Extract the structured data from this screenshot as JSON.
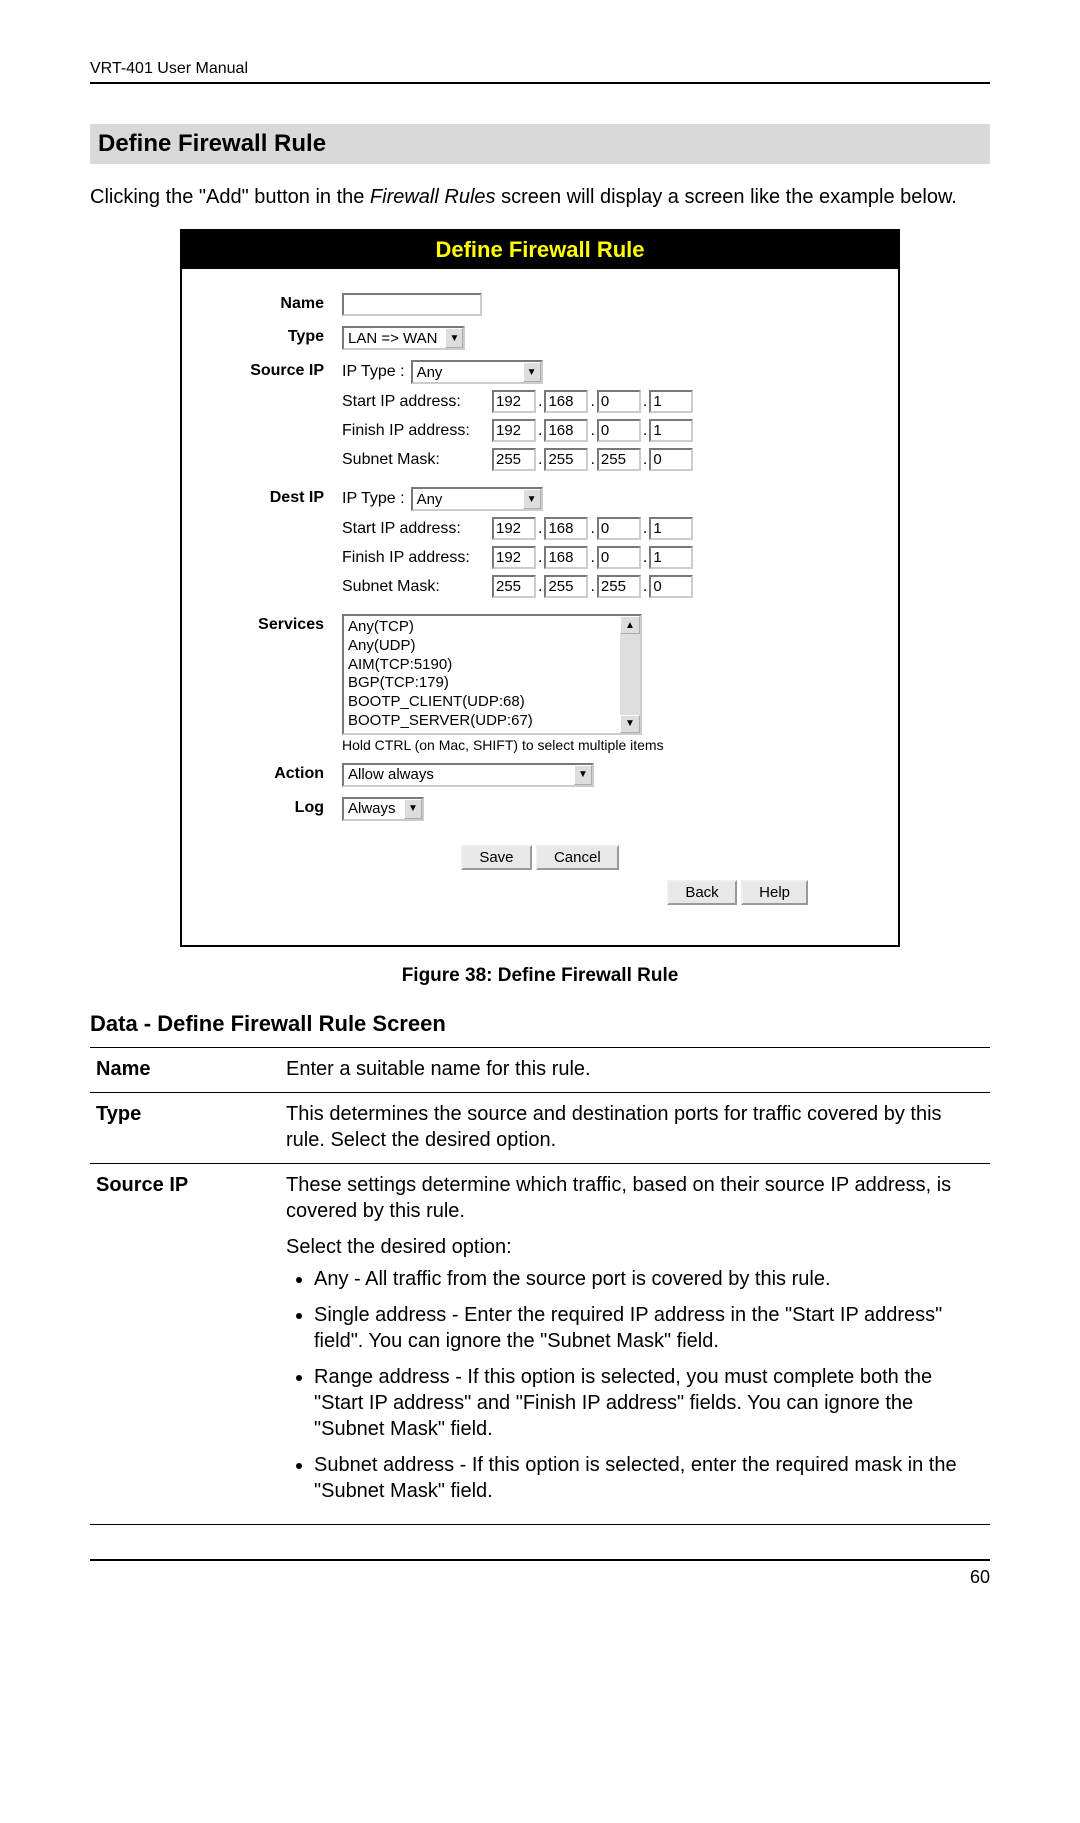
{
  "header": {
    "title": "VRT-401 User Manual"
  },
  "section": {
    "heading": "Define Firewall Rule",
    "intro_prefix": "Clicking the \"Add\" button in the ",
    "intro_italic": "Firewall Rules",
    "intro_suffix": " screen will display a screen like the example below."
  },
  "screenshot": {
    "title": "Define Firewall Rule",
    "labels": {
      "name": "Name",
      "type": "Type",
      "source_ip": "Source IP",
      "dest_ip": "Dest IP",
      "services": "Services",
      "action": "Action",
      "log": "Log",
      "ip_type": "IP Type :",
      "start_ip": "Start IP address:",
      "finish_ip": "Finish IP address:",
      "subnet": "Subnet Mask:"
    },
    "name_value": "",
    "type_value": "LAN => WAN",
    "source": {
      "ip_type": "Any",
      "start": [
        "192",
        "168",
        "0",
        "1"
      ],
      "finish": [
        "192",
        "168",
        "0",
        "1"
      ],
      "mask": [
        "255",
        "255",
        "255",
        "0"
      ]
    },
    "dest": {
      "ip_type": "Any",
      "start": [
        "192",
        "168",
        "0",
        "1"
      ],
      "finish": [
        "192",
        "168",
        "0",
        "1"
      ],
      "mask": [
        "255",
        "255",
        "255",
        "0"
      ]
    },
    "services": [
      "Any(TCP)",
      "Any(UDP)",
      "AIM(TCP:5190)",
      "BGP(TCP:179)",
      "BOOTP_CLIENT(UDP:68)",
      "BOOTP_SERVER(UDP:67)"
    ],
    "services_hint": "Hold CTRL (on Mac, SHIFT) to select multiple items",
    "action_value": "Allow always",
    "log_value": "Always",
    "buttons": {
      "save": "Save",
      "cancel": "Cancel",
      "back": "Back",
      "help": "Help"
    }
  },
  "figure_caption": "Figure 38: Define Firewall Rule",
  "data_section": {
    "heading": "Data - Define Firewall Rule Screen",
    "rows": {
      "name": {
        "label": "Name",
        "desc": "Enter a suitable name for this rule."
      },
      "type": {
        "label": "Type",
        "desc": "This determines the source and destination ports for traffic covered by this rule. Select the desired option."
      },
      "source_ip": {
        "label": "Source IP",
        "desc_intro": "These settings determine which traffic, based on their source IP address, is covered by this rule.",
        "desc_select": "Select the desired option:",
        "bullets": [
          "Any - All traffic from the source port is covered by this rule.",
          "Single address - Enter the required IP address in the \"Start IP address\" field\". You can ignore the \"Subnet Mask\" field.",
          "Range address - If this option is selected, you must complete both the \"Start IP address\" and \"Finish IP address\" fields. You can ignore the \"Subnet Mask\" field.",
          "Subnet address - If this option is selected, enter the required mask in the \"Subnet Mask\" field."
        ]
      }
    }
  },
  "footer": {
    "page": "60"
  }
}
